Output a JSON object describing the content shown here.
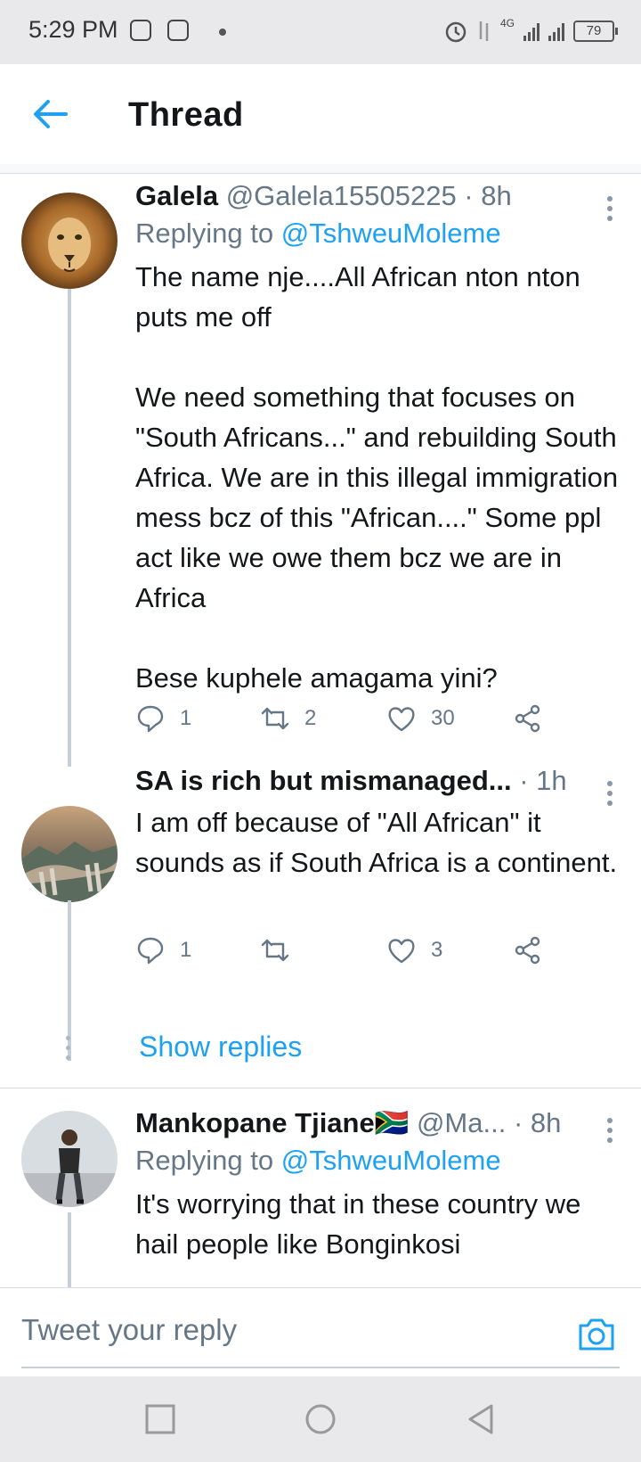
{
  "status_bar": {
    "time": "5:29 PM",
    "network": "4G",
    "battery": "79"
  },
  "header": {
    "title": "Thread"
  },
  "tweets": [
    {
      "name": "Galela",
      "handle": "@Galela15505225 · 8h",
      "replying_label": "Replying to",
      "replying_to": "@TshweuMoleme",
      "text": "The name nje....All African nton nton puts me off\n\nWe need something that focuses on \"South Africans...\" and rebuilding South Africa. We are in this illegal immigration mess bcz of this \"African....\" Some ppl act like we owe them bcz we are in Africa\n\nBese kuphele amagama yini?",
      "replies": "1",
      "retweets": "2",
      "likes": "30"
    },
    {
      "name": "SA is rich but mismanaged...",
      "handle": " · 1h",
      "text": "I am off because of \"All African\" it sounds as if South Africa is a continent.",
      "replies": "1",
      "retweets": "",
      "likes": "3"
    },
    {
      "name": "Mankopane Tjiane",
      "flag": "🇿🇦",
      "handle": " @Ma... · 8h",
      "replying_label": "Replying to",
      "replying_to": "@TshweuMoleme",
      "text": "It's worrying that in these country we hail people like Bonginkosi"
    }
  ],
  "show_replies": "Show replies",
  "reply_bar": {
    "placeholder": "Tweet your reply"
  },
  "colors": {
    "accent": "#1da1f2",
    "secondary_text": "#657786",
    "primary_text": "#14171a"
  }
}
